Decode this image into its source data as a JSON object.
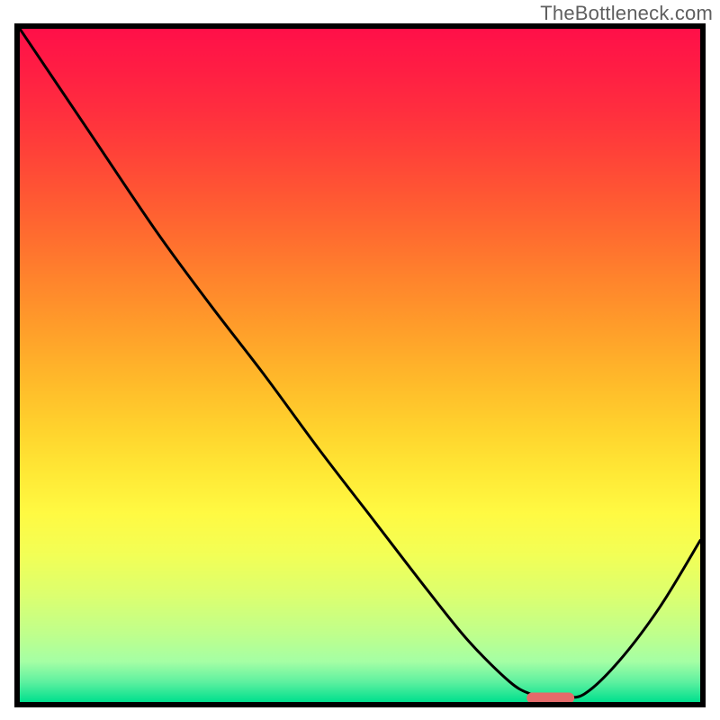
{
  "watermark_text": "TheBottleneck.com",
  "colors": {
    "frame": "#000000",
    "curve": "#000000",
    "marker": "#e56a6a",
    "gradient_stops": [
      {
        "t": 0.0,
        "hex": "#ff1049"
      },
      {
        "t": 0.06,
        "hex": "#ff1e44"
      },
      {
        "t": 0.12,
        "hex": "#ff2e3f"
      },
      {
        "t": 0.18,
        "hex": "#ff4139"
      },
      {
        "t": 0.24,
        "hex": "#ff5534"
      },
      {
        "t": 0.3,
        "hex": "#ff6a30"
      },
      {
        "t": 0.36,
        "hex": "#ff802d"
      },
      {
        "t": 0.42,
        "hex": "#ff952b"
      },
      {
        "t": 0.48,
        "hex": "#ffab2a"
      },
      {
        "t": 0.54,
        "hex": "#ffc02b"
      },
      {
        "t": 0.6,
        "hex": "#ffd52e"
      },
      {
        "t": 0.66,
        "hex": "#ffe936"
      },
      {
        "t": 0.72,
        "hex": "#fffa43"
      },
      {
        "t": 0.78,
        "hex": "#f3ff56"
      },
      {
        "t": 0.84,
        "hex": "#ddff6f"
      },
      {
        "t": 0.9,
        "hex": "#bfff8d"
      },
      {
        "t": 0.94,
        "hex": "#a5ffa5"
      },
      {
        "t": 0.97,
        "hex": "#5ff1a0"
      },
      {
        "t": 1.0,
        "hex": "#00e08e"
      }
    ]
  },
  "chart_data": {
    "type": "line",
    "title": "",
    "xlabel": "",
    "ylabel": "",
    "xlim": [
      0,
      100
    ],
    "ylim": [
      0,
      100
    ],
    "grid": false,
    "series": [
      {
        "name": "bottleneck-curve",
        "x": [
          0,
          10,
          20,
          28,
          36,
          44,
          52,
          60,
          66,
          72,
          75,
          77,
          80,
          83,
          88,
          94,
          100
        ],
        "y": [
          100,
          85,
          70,
          59,
          48.5,
          37.5,
          27,
          16.5,
          9,
          3,
          1.2,
          0.7,
          0.8,
          1.2,
          6,
          14,
          24
        ]
      }
    ],
    "annotations": [
      {
        "name": "min-marker",
        "shape": "rounded-rect",
        "x_center": 78,
        "y_center": 0.6,
        "width_x": 7,
        "height_y": 1.6
      }
    ]
  }
}
